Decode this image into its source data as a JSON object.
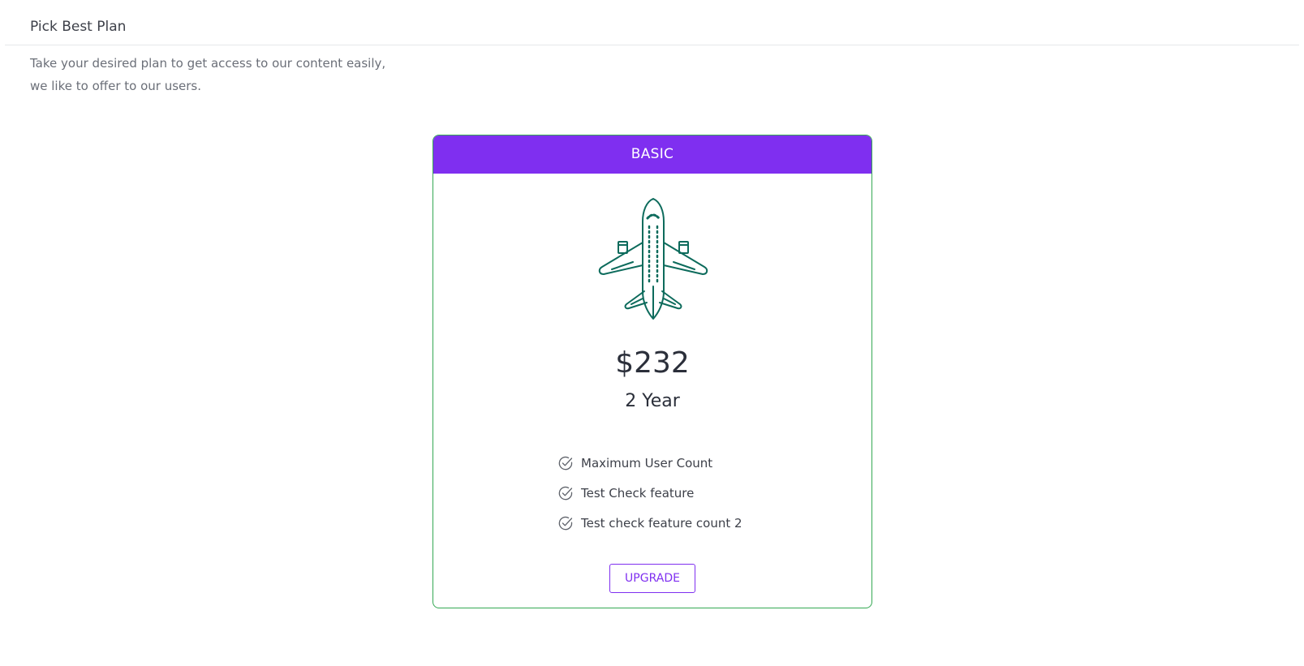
{
  "header": {
    "title": "Pick Best Plan"
  },
  "intro": {
    "line1": "Take your desired plan to get access to our content easily,",
    "line2": "we like to offer to our users."
  },
  "plan": {
    "name": "BASIC",
    "icon": "airplane-icon",
    "price": "$232",
    "duration": "2 Year",
    "features": [
      "Maximum User Count",
      "Test Check feature",
      "Test check feature count 2"
    ],
    "button_label": "UPGRADE"
  },
  "colors": {
    "accent": "#7f2ff0",
    "card_border": "#34a853",
    "icon": "#0d6b5c"
  }
}
